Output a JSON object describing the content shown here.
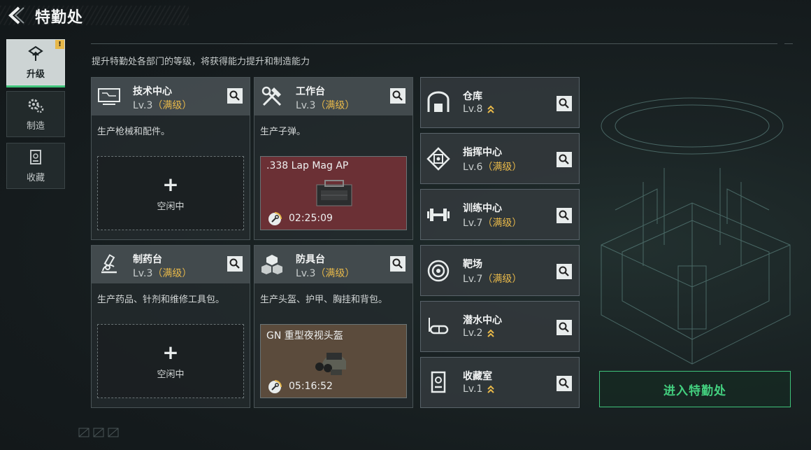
{
  "page": {
    "title": "特勤处",
    "subtitle": "提升特勤处各部门的等级，将获得能力提升和制造能力"
  },
  "side_tabs": [
    {
      "label": "升级",
      "icon": "upgrade-icon",
      "active": true,
      "badge": "!"
    },
    {
      "label": "制造",
      "icon": "gears-icon",
      "active": false
    },
    {
      "label": "收藏",
      "icon": "collection-icon",
      "active": false
    }
  ],
  "cards": [
    {
      "name": "技术中心",
      "level": "Lv.3",
      "max": "（满级）",
      "desc": "生产枪械和配件。",
      "icon": "tech-center-icon",
      "slot": {
        "state": "idle",
        "plus": "+",
        "text": "空闲中"
      }
    },
    {
      "name": "工作台",
      "level": "Lv.3",
      "max": "（满级）",
      "desc": "生产子弹。",
      "icon": "workbench-icon",
      "slot": {
        "state": "producing",
        "item": ".338 Lap Mag AP",
        "time": "02:25:09",
        "color": "#6b3035"
      }
    },
    {
      "name": "制药台",
      "level": "Lv.3",
      "max": "（满级）",
      "desc": "生产药品、针剂和维修工具包。",
      "icon": "pharmacy-icon",
      "slot": {
        "state": "idle",
        "plus": "+",
        "text": "空闲中"
      }
    },
    {
      "name": "防具台",
      "level": "Lv.3",
      "max": "（满级）",
      "desc": "生产头盔、护甲、胸挂和背包。",
      "icon": "armor-bench-icon",
      "slot": {
        "state": "producing",
        "item": "GN 重型夜视头盔",
        "time": "05:16:52",
        "color": "#5b4b3c"
      }
    }
  ],
  "small_cards": [
    {
      "name": "仓库",
      "level": "Lv.8",
      "max": "",
      "upgradable": true,
      "icon": "warehouse-icon"
    },
    {
      "name": "指挥中心",
      "level": "Lv.6",
      "max": "（满级）",
      "upgradable": false,
      "icon": "command-center-icon"
    },
    {
      "name": "训练中心",
      "level": "Lv.7",
      "max": "（满级）",
      "upgradable": false,
      "icon": "training-center-icon"
    },
    {
      "name": "靶场",
      "level": "Lv.7",
      "max": "（满级）",
      "upgradable": false,
      "icon": "shooting-range-icon"
    },
    {
      "name": "潜水中心",
      "level": "Lv.2",
      "max": "",
      "upgradable": true,
      "icon": "diving-center-icon"
    },
    {
      "name": "收藏室",
      "level": "Lv.1",
      "max": "",
      "upgradable": true,
      "icon": "collection-room-icon"
    }
  ],
  "enter_button": {
    "label": "进入特勤处"
  },
  "colors": {
    "accent_green": "#3fc37a",
    "max_gold": "#e7b84a"
  }
}
